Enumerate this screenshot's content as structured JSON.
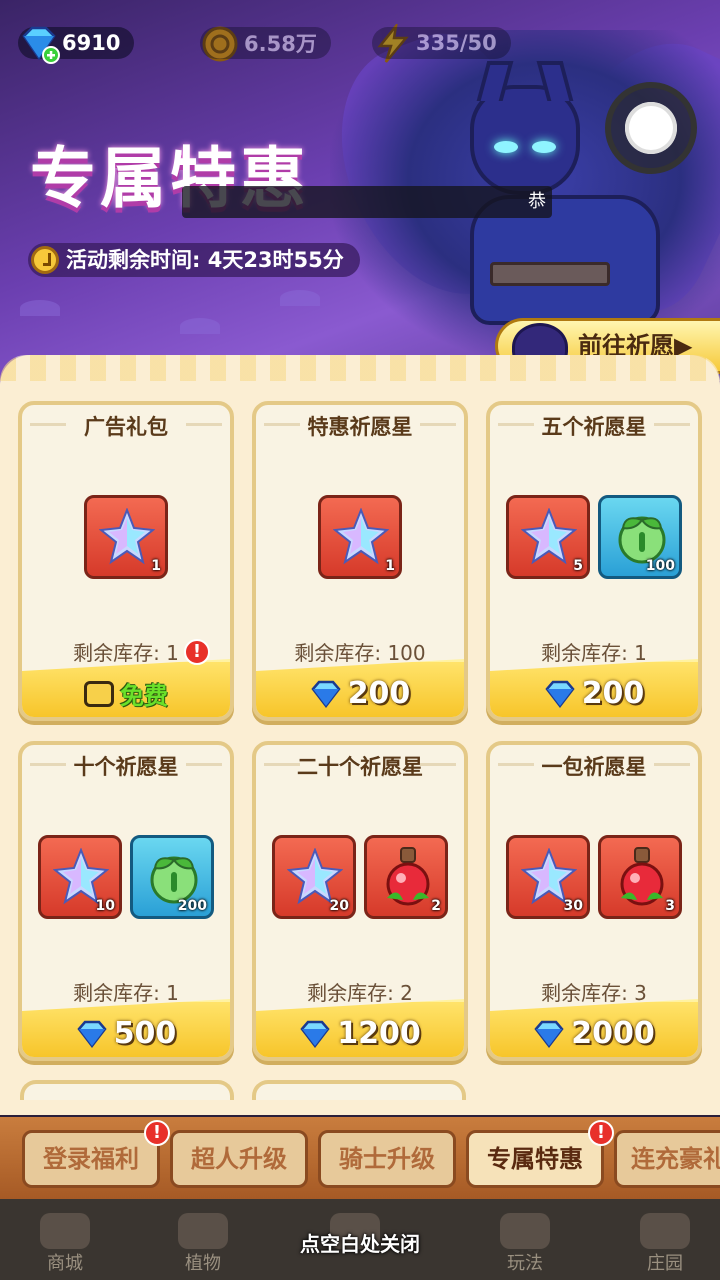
{
  "currency": {
    "diamonds": "6910",
    "gold": "6.58万",
    "energy": "335/50"
  },
  "banner": {
    "title": "专属特惠",
    "hidden_strip_text": "恭",
    "timer_label": "活动剩余时间: 4天23时55分",
    "wish_button": "前往祈愿▶"
  },
  "cards": [
    {
      "name": "广告礼包",
      "items": [
        {
          "type": "star",
          "qty": "1"
        }
      ],
      "stock": "剩余库存: 1",
      "price": "免费",
      "price_type": "ad",
      "badge": "!"
    },
    {
      "name": "特惠祈愿星",
      "items": [
        {
          "type": "star",
          "qty": "1"
        }
      ],
      "stock": "剩余库存: 100",
      "price": "200",
      "price_type": "diamond"
    },
    {
      "name": "五个祈愿星",
      "items": [
        {
          "type": "star",
          "qty": "5"
        },
        {
          "type": "leaf",
          "qty": "100"
        }
      ],
      "stock": "剩余库存: 1",
      "price": "200",
      "price_type": "diamond"
    },
    {
      "name": "十个祈愿星",
      "items": [
        {
          "type": "star",
          "qty": "10"
        },
        {
          "type": "leaf",
          "qty": "200"
        }
      ],
      "stock": "剩余库存: 1",
      "price": "500",
      "price_type": "diamond"
    },
    {
      "name": "二十个祈愿星",
      "items": [
        {
          "type": "star",
          "qty": "20"
        },
        {
          "type": "potion",
          "qty": "2"
        }
      ],
      "stock": "剩余库存: 2",
      "price": "1200",
      "price_type": "diamond"
    },
    {
      "name": "一包祈愿星",
      "items": [
        {
          "type": "star",
          "qty": "30"
        },
        {
          "type": "potion",
          "qty": "3"
        }
      ],
      "stock": "剩余库存: 3",
      "price": "2000",
      "price_type": "diamond"
    }
  ],
  "tabs": [
    {
      "label": "登录福利",
      "badge": "!"
    },
    {
      "label": "超人升级"
    },
    {
      "label": "骑士升级"
    },
    {
      "label": "专属特惠",
      "badge": "!",
      "active": true
    },
    {
      "label": "连充豪礼"
    }
  ],
  "bottom_nav": [
    "商城",
    "植物",
    "",
    "玩法",
    "庄园"
  ],
  "close_hint": "点空白处关闭",
  "colors": {
    "panel": "#fbeed3",
    "card_border": "#e4c987",
    "price_bar": "#f7c52a",
    "badge": "#e8302a",
    "banner": "#6b3fb0"
  }
}
